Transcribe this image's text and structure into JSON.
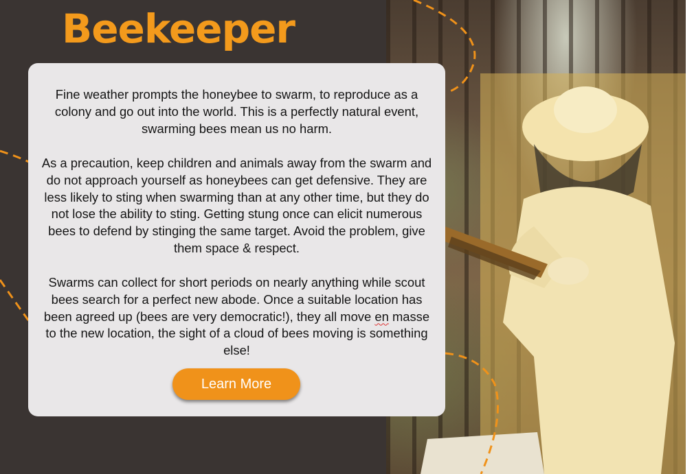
{
  "page": {
    "title": "Beekeeper"
  },
  "card": {
    "paragraphs": [
      "Fine weather prompts the honeybee to swarm, to reproduce as a colony and go out into the world. This is a perfectly natural event, swarming bees mean us no harm.",
      "As a precaution, keep children and animals away from the swarm and do not approach yourself as honeybees can get defensive. They are less likely to sting when swarming than at any other time, but they do not lose the ability to sting. Getting stung once can elicit numerous bees to defend by stinging the same target. Avoid the problem, give them space & respect.",
      {
        "before": "Swarms can collect for short periods on nearly anything while scout bees search for a perfect new abode. Once a suitable location has been agreed up (bees are very democratic!), they all move ",
        "flagged": "en",
        "after": " masse to the new location, the sight of a cloud of bees moving is something else!"
      }
    ],
    "button_label": "Learn More"
  },
  "colors": {
    "background": "#3a3432",
    "accent": "#f39a1c",
    "card": "#e9e7e8",
    "button": "#f0921a"
  },
  "image": {
    "subject": "beekeeper in protective suit holding a hive frame in a forest"
  }
}
